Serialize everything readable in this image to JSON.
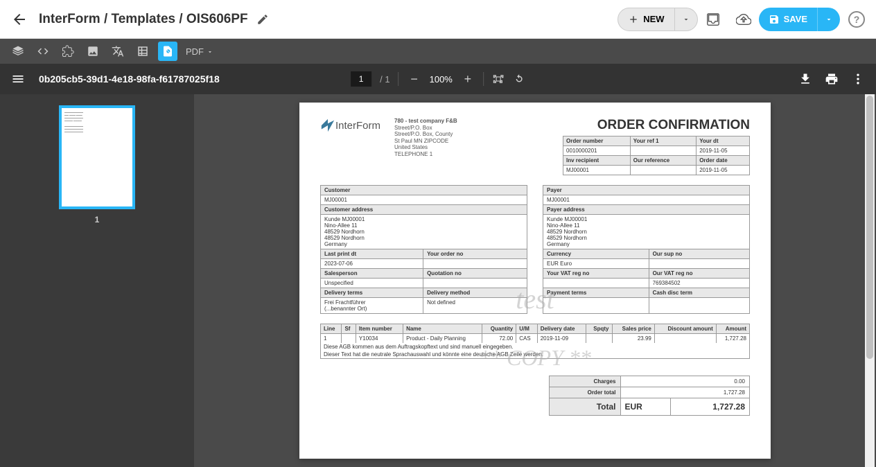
{
  "header": {
    "breadcrumb": "InterForm / Templates / OIS606PF",
    "new_label": "NEW",
    "save_label": "SAVE"
  },
  "toolbar2": {
    "pdf_label": "PDF"
  },
  "pdfbar": {
    "doc_id": "0b205cb5-39d1-4e18-98fa-f61787025f18",
    "page_current": "1",
    "page_total": "1",
    "zoom": "100%"
  },
  "sidebar": {
    "thumb_label": "1"
  },
  "doc": {
    "logo_text": "InterForm",
    "company": {
      "name": "780 - test company F&B",
      "l1": "Street/P.O. Box",
      "l2": "Street/P.O. Box, County",
      "l3": "St Paul MN ZIPCODE",
      "l4": "United States",
      "l5": "TELEPHONE 1"
    },
    "title": "ORDER CONFIRMATION",
    "meta": {
      "h_order_number": "Order number",
      "h_your_ref": "Your ref 1",
      "h_your_dt": "Your dt",
      "order_number": "0010000201",
      "your_ref": "",
      "your_dt": "2019-11-05",
      "h_inv_recipient": "Inv recipient",
      "h_our_reference": "Our reference",
      "h_order_date": "Order date",
      "inv_recipient": "MJ00001",
      "our_reference": "",
      "order_date": "2019-11-05"
    },
    "customer": {
      "h_customer": "Customer",
      "customer": "MJ00001",
      "h_address": "Customer address",
      "addr1": "Kunde MJ00001",
      "addr2": "Nino-Allee 11",
      "addr3": "48529 Nordhorn",
      "addr4": "48529 Nordhorn",
      "addr5": "Germany",
      "h_last_print": "Last print dt",
      "h_your_order": "Your order no",
      "last_print": "2023-07-06",
      "h_salesperson": "Salesperson",
      "h_quotation": "Quotation no",
      "salesperson": "Unspecified",
      "h_delivery_terms": "Delivery terms",
      "h_delivery_method": "Delivery method",
      "delivery_terms1": "Frei Frachtführer",
      "delivery_terms2": "(...benannter Ort)",
      "delivery_method": "Not defined"
    },
    "payer": {
      "h_payer": "Payer",
      "payer": "MJ00001",
      "h_address": "Payer address",
      "addr1": "Kunde MJ00001",
      "addr2": "Nino-Allee 11",
      "addr3": "48529 Nordhorn",
      "addr4": "48529 Nordhorn",
      "addr5": "Germany",
      "h_currency": "Currency",
      "h_our_sup": "Our sup no",
      "currency": "EUR  Euro",
      "h_your_vat": "Your VAT reg no",
      "h_our_vat": "Our VAT reg no",
      "our_vat": "769384502",
      "h_payment_terms": "Payment terms",
      "h_cash_disc": "Cash disc term"
    },
    "watermark1": "test",
    "watermark2": "** COPY **",
    "items": {
      "headers": {
        "line": "Line",
        "sf": "Sf",
        "item_number": "Item number",
        "name": "Name",
        "quantity": "Quantity",
        "um": "U/M",
        "delivery_date": "Delivery date",
        "spqty": "Spqty",
        "sales_price": "Sales price",
        "discount": "Discount amount",
        "amount": "Amount"
      },
      "rows": [
        {
          "line": "1",
          "sf": "",
          "item_number": "Y10034",
          "name": "Product - Daily Planning",
          "quantity": "72.00",
          "um": "CAS",
          "delivery_date": "2019-11-09",
          "spqty": "",
          "sales_price": "23.99",
          "discount": "",
          "amount": "1,727.28"
        }
      ],
      "notes": [
        "Diese AGB kommen aus dem Auftragskopftext und sind manuell eingegeben.",
        "Dieser Text hat die neutrale Sprachauswahl und könnte eine deutsche AGB Zeile werden."
      ]
    },
    "totals": {
      "charges_lbl": "Charges",
      "charges": "0.00",
      "order_total_lbl": "Order total",
      "order_total": "1,727.28",
      "total_lbl": "Total",
      "currency": "EUR",
      "grand": "1,727.28"
    }
  }
}
